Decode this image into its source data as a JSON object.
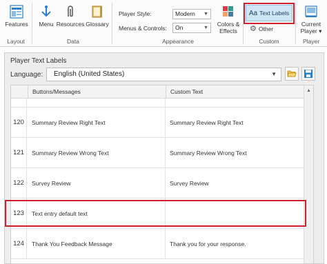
{
  "ribbon": {
    "layout": {
      "features_label": "Features",
      "group_label": "Layout"
    },
    "data": {
      "menu_label": "Menu",
      "resources_label": "Resources",
      "glossary_label": "Glossary",
      "group_label": "Data"
    },
    "appearance": {
      "player_style_label": "Player Style:",
      "player_style_value": "Modern",
      "menus_controls_label": "Menus & Controls:",
      "menus_controls_value": "On",
      "colors_effects_label_line1": "Colors &",
      "colors_effects_label_line2": "Effects",
      "group_label": "Appearance"
    },
    "custom": {
      "text_labels_label": "Text Labels",
      "other_label": "Other",
      "group_label": "Custom"
    },
    "player": {
      "current_player_line1": "Current",
      "current_player_line2": "Player",
      "group_label": "Player"
    }
  },
  "panel": {
    "title": "Player Text Labels",
    "language_label": "Language:",
    "language_value": "English (United States)"
  },
  "table": {
    "columns": [
      "Buttons/Messages",
      "Custom Text"
    ],
    "rows": [
      {
        "num": "120",
        "message": "Summary Review Right Text",
        "custom": "Summary Review Right Text"
      },
      {
        "num": "121",
        "message": "Summary Review Wrong Text",
        "custom": "Summary Review Wrong Text"
      },
      {
        "num": "122",
        "message": "Survey Review",
        "custom": "Survey Review"
      },
      {
        "num": "123",
        "message": "Text entry default text",
        "custom": ""
      },
      {
        "num": "124",
        "message": "Thank You Feedback Message",
        "custom": "Thank you for your response."
      }
    ]
  },
  "colors": {
    "highlight": "#d21f2e",
    "selected_button": "#cfe6f7"
  }
}
